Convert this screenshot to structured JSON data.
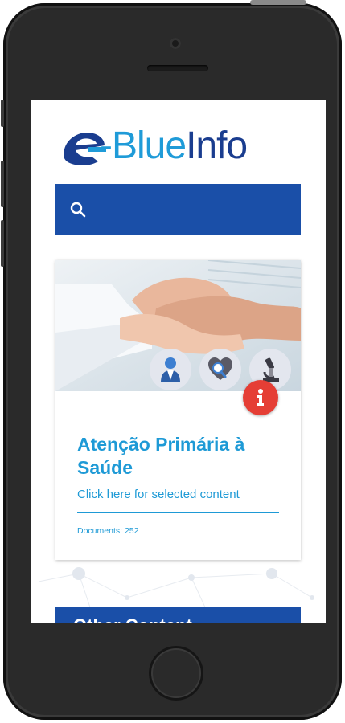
{
  "app": {
    "logo_mark_letter": "e",
    "logo_text_blue": "-Blue",
    "logo_text_dark": "Info"
  },
  "search": {
    "icon": "search-icon"
  },
  "card": {
    "title": "Atenção Primária à Saúde",
    "link": "Click here for selected content",
    "documents": "Documents: 252",
    "icons": [
      "doctor-icon",
      "heart-magnifier-icon",
      "microscope-icon"
    ],
    "info_badge": "i"
  },
  "other_section": {
    "title": "Other Content"
  },
  "colors": {
    "brand_dark": "#1a4fa8",
    "brand_light": "#1e9ad6",
    "badge_red": "#e53e35"
  }
}
